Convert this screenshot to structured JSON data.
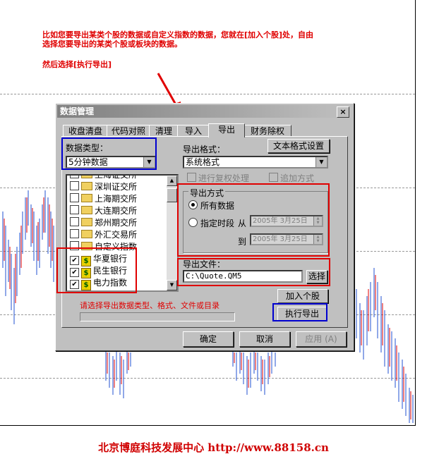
{
  "annotations": {
    "line1": "比如您要导出某类个股的数据或自定义指数的数据，您就在[加入个股]处，自由",
    "line2": "选择您要导出的某类个股或板块的数据。",
    "line3": "然后选择[执行导出]",
    "hint": "请选择导出数据类型、格式、文件或目录"
  },
  "footer": "北京博庭科技发展中心   http://www.88158.cn",
  "dialog": {
    "title": "数据管理",
    "close": "×",
    "tabs": [
      "收盘清盘",
      "代码对照",
      "清理",
      "导入",
      "导出",
      "财务除权"
    ],
    "data_type_label": "数据类型：",
    "data_type_value": "5分钟数据",
    "export_format_label": "导出格式：",
    "text_format_button": "文本格式设置",
    "export_format_value": "系统格式",
    "rights_check": "进行复权处理",
    "append_check": "追加方式",
    "list": [
      {
        "type": "folder",
        "label": "上海证交所",
        "checked": false
      },
      {
        "type": "folder",
        "label": "深圳证交所",
        "checked": false
      },
      {
        "type": "folder",
        "label": "上海期交所",
        "checked": false
      },
      {
        "type": "folder",
        "label": "大连期交所",
        "checked": false
      },
      {
        "type": "folder",
        "label": "郑州期交所",
        "checked": false
      },
      {
        "type": "folder",
        "label": "外汇交易所",
        "checked": false
      },
      {
        "type": "folder",
        "label": "自定义指数",
        "checked": false
      },
      {
        "type": "stock",
        "label": "华夏银行",
        "checked": true
      },
      {
        "type": "stock",
        "label": "民生银行",
        "checked": true
      },
      {
        "type": "stock",
        "label": "电力指数",
        "checked": true
      }
    ],
    "export_mode": {
      "legend": "导出方式",
      "all": "所有数据",
      "period": "指定时段",
      "from_label": "从",
      "to_label": "到",
      "from_date": "2005年 3月25日",
      "to_date": "2005年 3月25日"
    },
    "export_file_label": "导出文件：",
    "export_file_value": "C:\\Quote.QM5",
    "browse_button": "选择",
    "add_stock_button": "加入个股",
    "execute_button": "执行导出",
    "ok_button": "确定",
    "cancel_button": "取消",
    "apply_button": "应用 (A)"
  }
}
